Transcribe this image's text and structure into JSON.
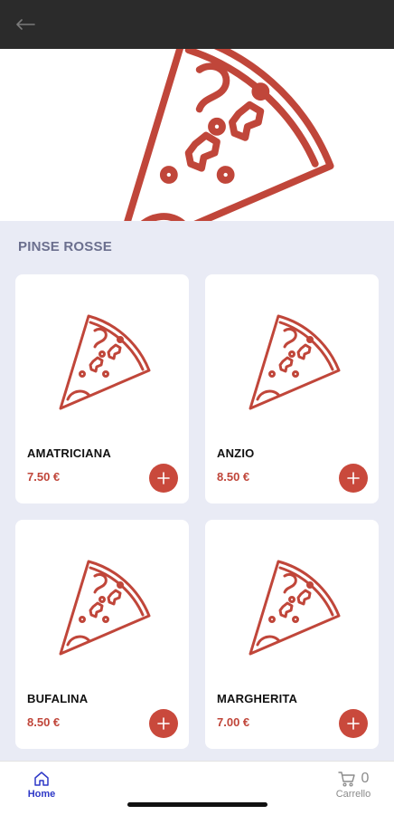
{
  "header": {
    "back_icon": "arrow-left-icon"
  },
  "hero": {
    "icon": "pizza-slice-icon",
    "accent_color": "#c0463a"
  },
  "section": {
    "title": "PINSE ROSSE"
  },
  "products": [
    {
      "name": "AMATRICIANA",
      "price": "7.50 €"
    },
    {
      "name": "ANZIO",
      "price": "8.50 €"
    },
    {
      "name": "BUFALINA",
      "price": "8.50 €"
    },
    {
      "name": "MARGHERITA",
      "price": "7.00 €"
    }
  ],
  "bottom_nav": {
    "home_label": "Home",
    "cart_label": "Carrello",
    "cart_count": "0",
    "active_color": "#2e38c7"
  }
}
